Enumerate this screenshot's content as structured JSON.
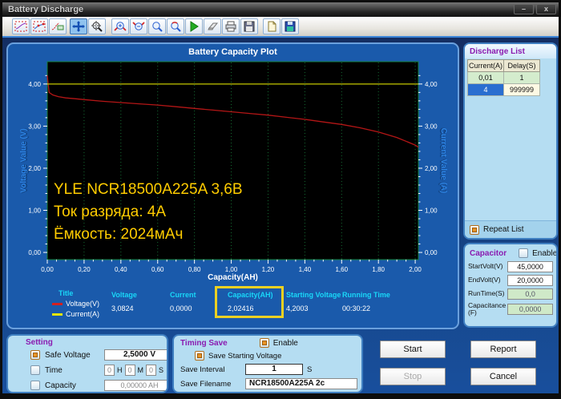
{
  "window": {
    "title": "Battery Discharge",
    "minimize_glyph": "–",
    "close_glyph": "x"
  },
  "toolbar": {
    "icons": [
      "curve-style-icon",
      "curve-points-icon",
      "curve-legend-icon",
      "pan-icon",
      "zoom-area-icon",
      "zoom-in-icon",
      "zoom-out-icon",
      "zoom-window-icon",
      "zoom-reset-icon",
      "run-icon",
      "erase-icon",
      "print-icon",
      "save-icon",
      "new-report-icon",
      "save-data-icon"
    ]
  },
  "chart": {
    "title": "Battery Capacity Plot",
    "xlabel": "Capacity(AH)",
    "ylabel_left": "Voltage Value (V)",
    "ylabel_right": "Current Value (A)",
    "annotation_color": "#ffcc00"
  },
  "chart_data": {
    "type": "line",
    "title": "Battery Capacity Plot",
    "xlabel": "Capacity(AH)",
    "ylabel_left": "Voltage Value (V)",
    "ylabel_right": "Current Value (A)",
    "xlim": [
      0,
      2.017
    ],
    "ylim": [
      -0.17,
      4.53
    ],
    "x_ticks": [
      0,
      0.2,
      0.4,
      0.6,
      0.8,
      1.0,
      1.2,
      1.4,
      1.6,
      1.8,
      2.0
    ],
    "x_tick_labels": [
      "0,00",
      "0,20",
      "0,40",
      "0,60",
      "0,80",
      "1,00",
      "1,20",
      "1,40",
      "1,60",
      "1,80",
      "2,00"
    ],
    "y_ticks": [
      0,
      1,
      2,
      3,
      4
    ],
    "y_tick_labels": [
      "0,00",
      "1,00",
      "2,00",
      "3,00",
      "4,00"
    ],
    "grid": "vertical-dotted",
    "legend_position": "below-left",
    "series": [
      {
        "name": "Voltage(V)",
        "color": "#b41616",
        "axis": "left",
        "points": [
          [
            0,
            4.2
          ],
          [
            0.01,
            3.8
          ],
          [
            0.03,
            3.74
          ],
          [
            0.06,
            3.7
          ],
          [
            0.1,
            3.67
          ],
          [
            0.15,
            3.65
          ],
          [
            0.2,
            3.63
          ],
          [
            0.3,
            3.59
          ],
          [
            0.4,
            3.56
          ],
          [
            0.5,
            3.53
          ],
          [
            0.6,
            3.5
          ],
          [
            0.7,
            3.46
          ],
          [
            0.8,
            3.42
          ],
          [
            0.9,
            3.38
          ],
          [
            1.0,
            3.34
          ],
          [
            1.1,
            3.3
          ],
          [
            1.2,
            3.26
          ],
          [
            1.3,
            3.21
          ],
          [
            1.4,
            3.16
          ],
          [
            1.5,
            3.1
          ],
          [
            1.6,
            3.04
          ],
          [
            1.7,
            2.96
          ],
          [
            1.8,
            2.86
          ],
          [
            1.9,
            2.73
          ],
          [
            1.95,
            2.64
          ],
          [
            2.0,
            2.55
          ],
          [
            2.017,
            2.5
          ]
        ]
      },
      {
        "name": "Current(A)",
        "color": "#c3c600",
        "axis": "right",
        "points": [
          [
            0,
            4.0
          ],
          [
            2.017,
            4.0
          ]
        ]
      }
    ],
    "annotation_lines": [
      "YLE NCR18500A225A 3,6В",
      "Ток разряда: 4А",
      "Ёмкость: 2024мАч"
    ]
  },
  "stats": {
    "title_header": "Title",
    "legend": [
      {
        "label": "Voltage(V)",
        "color": "#d42020"
      },
      {
        "label": "Current(A)",
        "color": "#e6e600"
      }
    ],
    "columns": [
      {
        "header": "Voltage",
        "value": "3,0824"
      },
      {
        "header": "Current",
        "value": "0,0000"
      },
      {
        "header": "Capacity(AH)",
        "value": "2,02416",
        "highlighted": true
      },
      {
        "header": "Starting Voltage",
        "value": "4,2003"
      },
      {
        "header": "Running Time",
        "value": "00:30:22"
      }
    ]
  },
  "discharge_list": {
    "title": "Discharge List",
    "headers": [
      "Current(A)",
      "Delay(S)"
    ],
    "rows": [
      [
        "0,01",
        "1"
      ],
      [
        "4",
        "999999"
      ]
    ],
    "selected_cell": "row2-current",
    "repeat_label": "Repeat List",
    "repeat_checked": true
  },
  "capacitor": {
    "title": "Capacitor",
    "enable_label": "Enable",
    "enable_checked": false,
    "fields": [
      {
        "label": "StartVolt(V)",
        "value": "45,0000",
        "readonly": false
      },
      {
        "label": "EndVolt(V)",
        "value": "20,0000",
        "readonly": false
      },
      {
        "label": "RunTime(S)",
        "value": "0,0",
        "readonly": true
      },
      {
        "label": "Capacitance (F)",
        "value": "0,0000",
        "readonly": true
      }
    ]
  },
  "setting": {
    "title": "Setting",
    "safe_voltage": {
      "label": "Safe Voltage",
      "value": "2,5000 V",
      "checked": true
    },
    "time": {
      "label": "Time",
      "h": "0",
      "m": "0",
      "s": "0",
      "unit_h": "H",
      "unit_m": "M",
      "unit_s": "S",
      "checked": false
    },
    "capacity": {
      "label": "Capacity",
      "value": "0,00000 AH",
      "checked": false
    }
  },
  "timing_save": {
    "title": "Timing Save",
    "enable_label": "Enable",
    "enable_checked": true,
    "save_starting_label": "Save Starting Voltage",
    "save_starting_checked": true,
    "interval_label": "Save Interval",
    "interval_value": "1",
    "interval_unit": "S",
    "filename_label": "Save Filename",
    "filename_value": "NCR18500A225A 2c"
  },
  "actions": {
    "start": "Start",
    "report": "Report",
    "stop": "Stop",
    "cancel": "Cancel"
  }
}
